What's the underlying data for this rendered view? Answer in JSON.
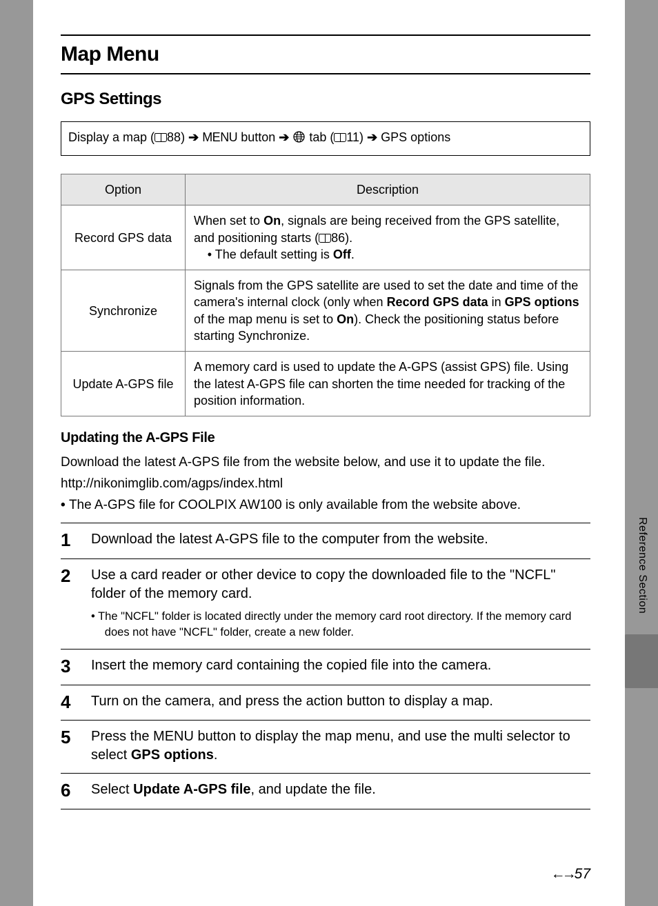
{
  "header": {
    "title": "Map Menu"
  },
  "section": {
    "title": "GPS Settings"
  },
  "nav": {
    "part1": "Display a map (",
    "ref1": "88) ",
    "menu_label": "MENU",
    "button_word": " button ",
    "tab_word": " tab (",
    "ref2": "11) ",
    "last": " GPS options"
  },
  "table": {
    "head_option": "Option",
    "head_desc": "Description",
    "rows": [
      {
        "option": "Record GPS data",
        "desc_pre": "When set to ",
        "desc_bold1": "On",
        "desc_mid": ", signals are being received from the GPS satellite, and positioning starts (",
        "desc_ref": "86).",
        "bullet_pre": "•  The default setting is ",
        "bullet_bold": "Off",
        "bullet_post": "."
      },
      {
        "option": "Synchronize",
        "desc1": "Signals from the GPS satellite are used to set the date and time of the camera's internal clock (only when ",
        "b1": "Record GPS data",
        "desc2": " in ",
        "b2": "GPS options",
        "desc3": " of the map menu is set to ",
        "b3": "On",
        "desc4": "). Check the positioning status before starting Synchronize."
      },
      {
        "option": "Update A-GPS file",
        "desc": "A memory card is used to update the A-GPS (assist GPS) file. Using the latest A-GPS file can shorten the time needed for tracking of the position information."
      }
    ]
  },
  "update": {
    "heading": "Updating the A-GPS File",
    "intro": "Download the latest A-GPS file from the website below, and use it to update the file.",
    "url": "http://nikonimglib.com/agps/index.html",
    "note": "The A-GPS file for COOLPIX AW100 is only available from the website above."
  },
  "steps": [
    {
      "n": "1",
      "text": "Download the latest A-GPS file to the computer from the website."
    },
    {
      "n": "2",
      "text": "Use a card reader or other device to copy the downloaded file to the \"NCFL\" folder of the memory card.",
      "sub": "The \"NCFL\" folder is located directly under the memory card root directory. If the memory card does not have \"NCFL\" folder, create a new folder."
    },
    {
      "n": "3",
      "text": "Insert the memory card containing the copied file into the camera."
    },
    {
      "n": "4",
      "text": "Turn on the camera, and press the action button to display a map."
    },
    {
      "n": "5",
      "text_pre": "Press the ",
      "menu": "MENU",
      "text_post": " button to display the map menu, and use the multi selector to select ",
      "bold": "GPS options",
      "tail": "."
    },
    {
      "n": "6",
      "text_pre": "Select ",
      "bold": "Update A-GPS file",
      "text_post": ", and update the file."
    }
  ],
  "side": {
    "label": "Reference Section"
  },
  "page_number": "57"
}
